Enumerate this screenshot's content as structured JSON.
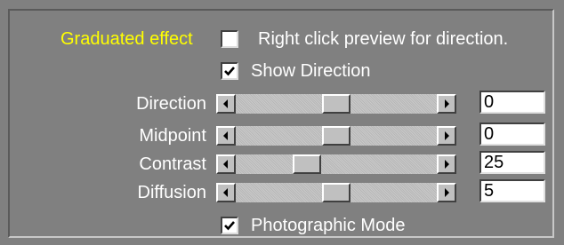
{
  "graduated_label": "Graduated effect",
  "graduated_checked": false,
  "hint_text": "Right click preview for direction.",
  "show_direction": {
    "label": "Show Direction",
    "checked": true
  },
  "sliders": [
    {
      "label": "Direction",
      "value": "0",
      "position": 0.5
    },
    {
      "label": "Midpoint",
      "value": "0",
      "position": 0.5
    },
    {
      "label": "Contrast",
      "value": "25",
      "position": 0.33
    },
    {
      "label": "Diffusion",
      "value": "5",
      "position": 0.5
    }
  ],
  "photographic_mode": {
    "label": "Photographic Mode",
    "checked": true
  },
  "colors": {
    "background": "#808080",
    "graduated_label": "#ffff00",
    "label": "#ffffff"
  },
  "icons": [
    "checkmark-icon",
    "arrow-left-icon",
    "arrow-right-icon"
  ]
}
